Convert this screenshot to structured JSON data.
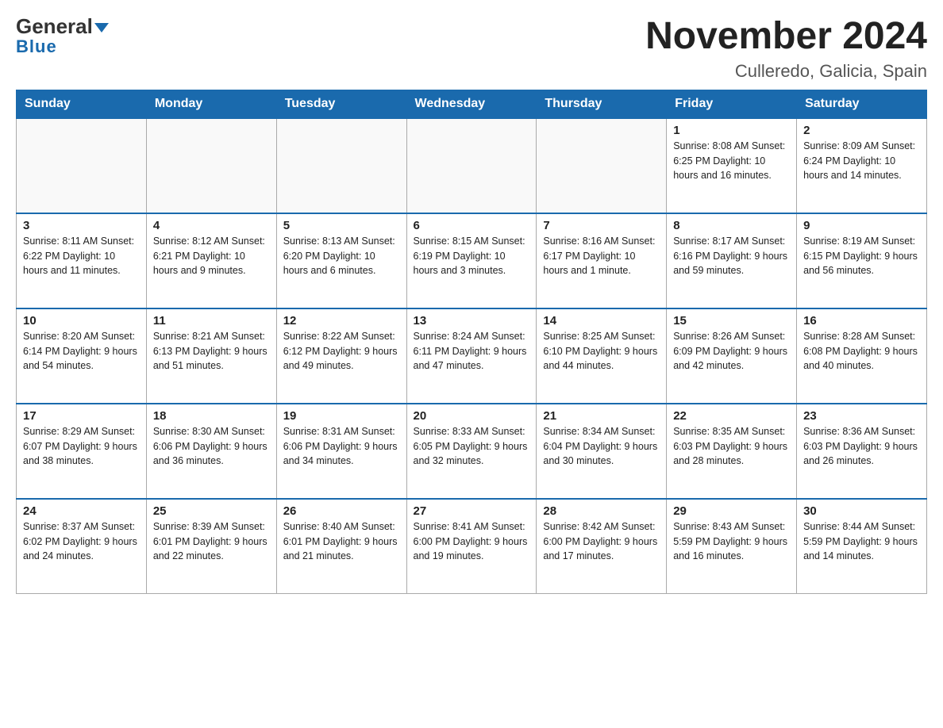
{
  "header": {
    "logo_general": "General",
    "logo_blue": "Blue",
    "title": "November 2024",
    "subtitle": "Culleredo, Galicia, Spain"
  },
  "days_of_week": [
    "Sunday",
    "Monday",
    "Tuesday",
    "Wednesday",
    "Thursday",
    "Friday",
    "Saturday"
  ],
  "weeks": [
    [
      {
        "day": "",
        "info": ""
      },
      {
        "day": "",
        "info": ""
      },
      {
        "day": "",
        "info": ""
      },
      {
        "day": "",
        "info": ""
      },
      {
        "day": "",
        "info": ""
      },
      {
        "day": "1",
        "info": "Sunrise: 8:08 AM\nSunset: 6:25 PM\nDaylight: 10 hours\nand 16 minutes."
      },
      {
        "day": "2",
        "info": "Sunrise: 8:09 AM\nSunset: 6:24 PM\nDaylight: 10 hours\nand 14 minutes."
      }
    ],
    [
      {
        "day": "3",
        "info": "Sunrise: 8:11 AM\nSunset: 6:22 PM\nDaylight: 10 hours\nand 11 minutes."
      },
      {
        "day": "4",
        "info": "Sunrise: 8:12 AM\nSunset: 6:21 PM\nDaylight: 10 hours\nand 9 minutes."
      },
      {
        "day": "5",
        "info": "Sunrise: 8:13 AM\nSunset: 6:20 PM\nDaylight: 10 hours\nand 6 minutes."
      },
      {
        "day": "6",
        "info": "Sunrise: 8:15 AM\nSunset: 6:19 PM\nDaylight: 10 hours\nand 3 minutes."
      },
      {
        "day": "7",
        "info": "Sunrise: 8:16 AM\nSunset: 6:17 PM\nDaylight: 10 hours\nand 1 minute."
      },
      {
        "day": "8",
        "info": "Sunrise: 8:17 AM\nSunset: 6:16 PM\nDaylight: 9 hours\nand 59 minutes."
      },
      {
        "day": "9",
        "info": "Sunrise: 8:19 AM\nSunset: 6:15 PM\nDaylight: 9 hours\nand 56 minutes."
      }
    ],
    [
      {
        "day": "10",
        "info": "Sunrise: 8:20 AM\nSunset: 6:14 PM\nDaylight: 9 hours\nand 54 minutes."
      },
      {
        "day": "11",
        "info": "Sunrise: 8:21 AM\nSunset: 6:13 PM\nDaylight: 9 hours\nand 51 minutes."
      },
      {
        "day": "12",
        "info": "Sunrise: 8:22 AM\nSunset: 6:12 PM\nDaylight: 9 hours\nand 49 minutes."
      },
      {
        "day": "13",
        "info": "Sunrise: 8:24 AM\nSunset: 6:11 PM\nDaylight: 9 hours\nand 47 minutes."
      },
      {
        "day": "14",
        "info": "Sunrise: 8:25 AM\nSunset: 6:10 PM\nDaylight: 9 hours\nand 44 minutes."
      },
      {
        "day": "15",
        "info": "Sunrise: 8:26 AM\nSunset: 6:09 PM\nDaylight: 9 hours\nand 42 minutes."
      },
      {
        "day": "16",
        "info": "Sunrise: 8:28 AM\nSunset: 6:08 PM\nDaylight: 9 hours\nand 40 minutes."
      }
    ],
    [
      {
        "day": "17",
        "info": "Sunrise: 8:29 AM\nSunset: 6:07 PM\nDaylight: 9 hours\nand 38 minutes."
      },
      {
        "day": "18",
        "info": "Sunrise: 8:30 AM\nSunset: 6:06 PM\nDaylight: 9 hours\nand 36 minutes."
      },
      {
        "day": "19",
        "info": "Sunrise: 8:31 AM\nSunset: 6:06 PM\nDaylight: 9 hours\nand 34 minutes."
      },
      {
        "day": "20",
        "info": "Sunrise: 8:33 AM\nSunset: 6:05 PM\nDaylight: 9 hours\nand 32 minutes."
      },
      {
        "day": "21",
        "info": "Sunrise: 8:34 AM\nSunset: 6:04 PM\nDaylight: 9 hours\nand 30 minutes."
      },
      {
        "day": "22",
        "info": "Sunrise: 8:35 AM\nSunset: 6:03 PM\nDaylight: 9 hours\nand 28 minutes."
      },
      {
        "day": "23",
        "info": "Sunrise: 8:36 AM\nSunset: 6:03 PM\nDaylight: 9 hours\nand 26 minutes."
      }
    ],
    [
      {
        "day": "24",
        "info": "Sunrise: 8:37 AM\nSunset: 6:02 PM\nDaylight: 9 hours\nand 24 minutes."
      },
      {
        "day": "25",
        "info": "Sunrise: 8:39 AM\nSunset: 6:01 PM\nDaylight: 9 hours\nand 22 minutes."
      },
      {
        "day": "26",
        "info": "Sunrise: 8:40 AM\nSunset: 6:01 PM\nDaylight: 9 hours\nand 21 minutes."
      },
      {
        "day": "27",
        "info": "Sunrise: 8:41 AM\nSunset: 6:00 PM\nDaylight: 9 hours\nand 19 minutes."
      },
      {
        "day": "28",
        "info": "Sunrise: 8:42 AM\nSunset: 6:00 PM\nDaylight: 9 hours\nand 17 minutes."
      },
      {
        "day": "29",
        "info": "Sunrise: 8:43 AM\nSunset: 5:59 PM\nDaylight: 9 hours\nand 16 minutes."
      },
      {
        "day": "30",
        "info": "Sunrise: 8:44 AM\nSunset: 5:59 PM\nDaylight: 9 hours\nand 14 minutes."
      }
    ]
  ]
}
